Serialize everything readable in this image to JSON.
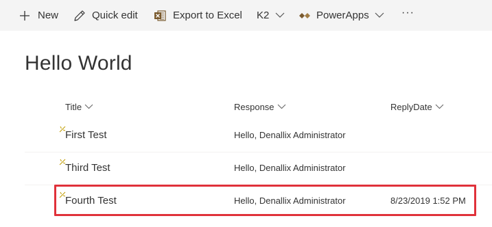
{
  "toolbar": {
    "new_label": "New",
    "quick_edit_label": "Quick edit",
    "export_label": "Export to Excel",
    "k2_label": "K2",
    "powerapps_label": "PowerApps",
    "more_label": "···",
    "icons": [
      "plus-icon",
      "pencil-icon",
      "excel-icon",
      "chevron-down-icon",
      "powerapps-icon",
      "ellipsis-icon"
    ]
  },
  "page": {
    "title": "Hello World"
  },
  "columns": [
    "Title",
    "Response",
    "ReplyDate"
  ],
  "rows": [
    {
      "title": "First Test",
      "response": "Hello, Denallix Administrator",
      "reply_date": ""
    },
    {
      "title": "Third Test",
      "response": "Hello, Denallix Administrator",
      "reply_date": ""
    },
    {
      "title": "Fourth Test",
      "response": "Hello, Denallix Administrator",
      "reply_date": "8/23/2019 1:52 PM"
    }
  ],
  "colors": {
    "toolbar_bg": "#f4f4f4",
    "text": "#333333",
    "excel_green": "#8a6d3b",
    "highlight": "#e0313a",
    "new_marker": "#c19c00"
  }
}
